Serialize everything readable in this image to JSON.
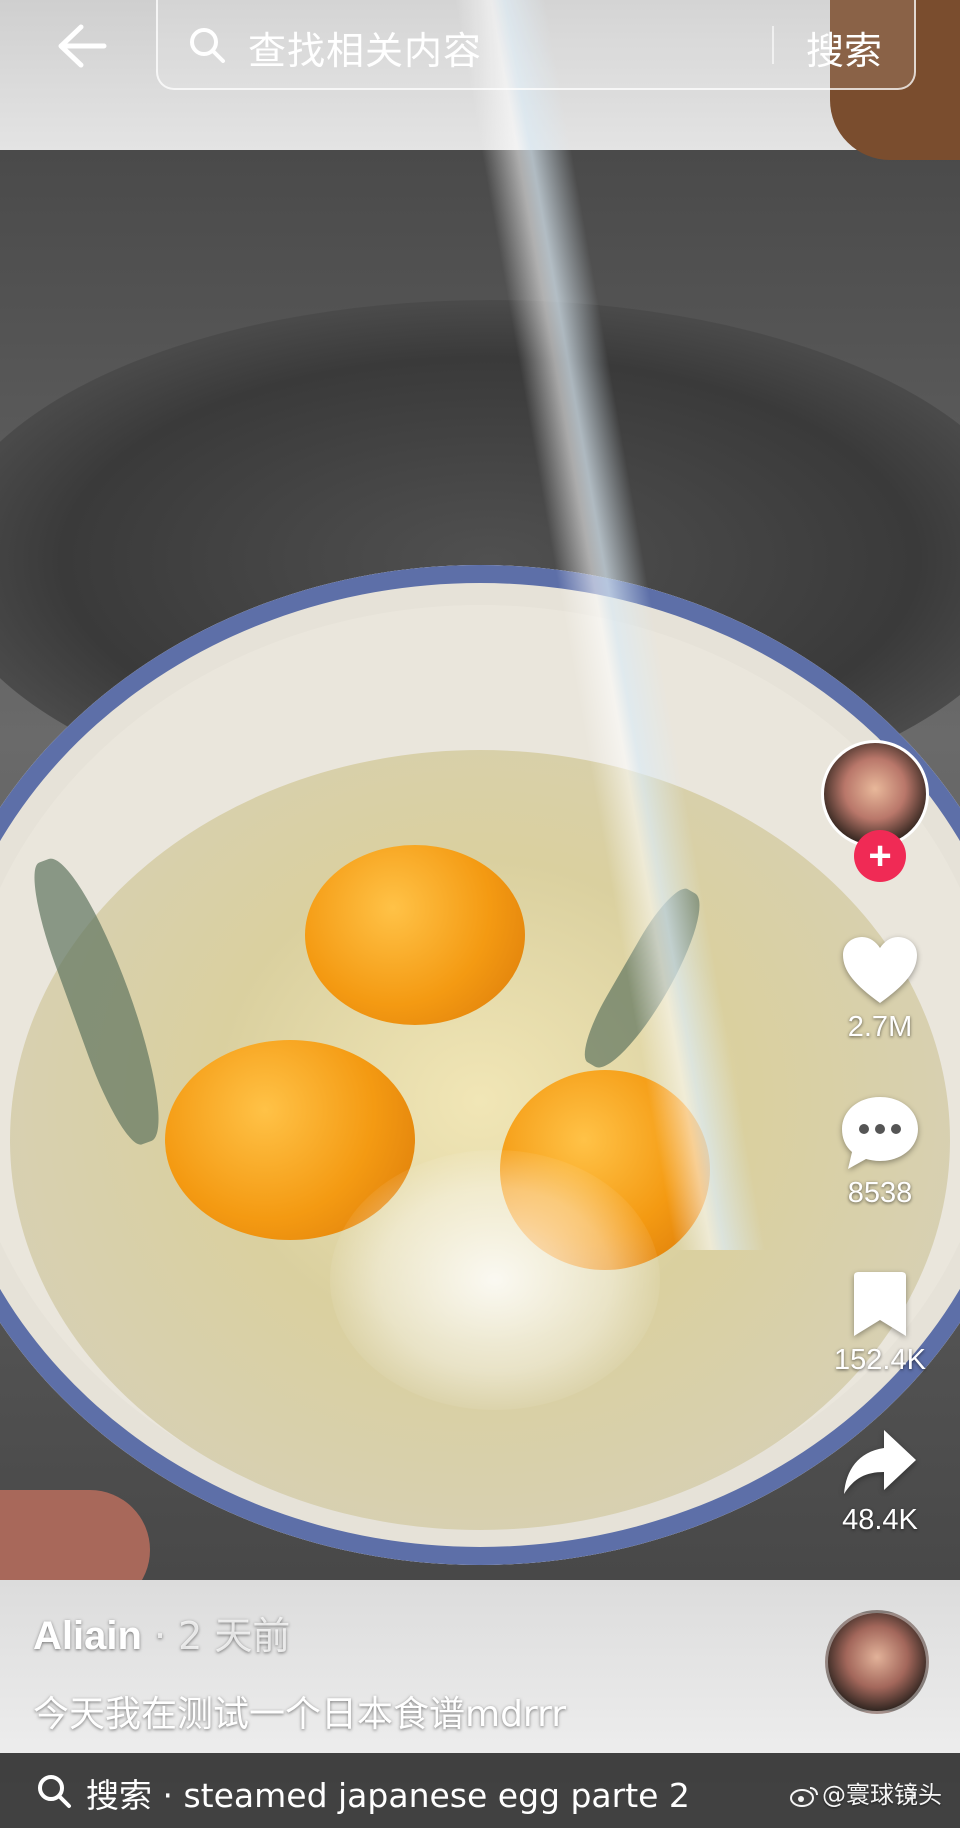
{
  "top_bar": {
    "search_placeholder": "查找相关内容",
    "search_button": "搜索"
  },
  "rail": {
    "likes": "2.7M",
    "comments": "8538",
    "saves": "152.4K",
    "shares": "48.4K",
    "follow_symbol": "+",
    "icons": [
      "heart-icon",
      "comment-icon",
      "bookmark-icon",
      "share-icon"
    ]
  },
  "post": {
    "author": "Aliain",
    "meta": " · 2 天前",
    "caption": "今天我在测试一个日本食谱mdrrr"
  },
  "bottom_bar": {
    "search_text": "搜索 · steamed japanese egg parte 2",
    "chevron": "›"
  },
  "watermark": {
    "text": "@寰球镜头"
  },
  "colors": {
    "follow_button": "#f02a55",
    "icon_color": "#ffffff"
  }
}
